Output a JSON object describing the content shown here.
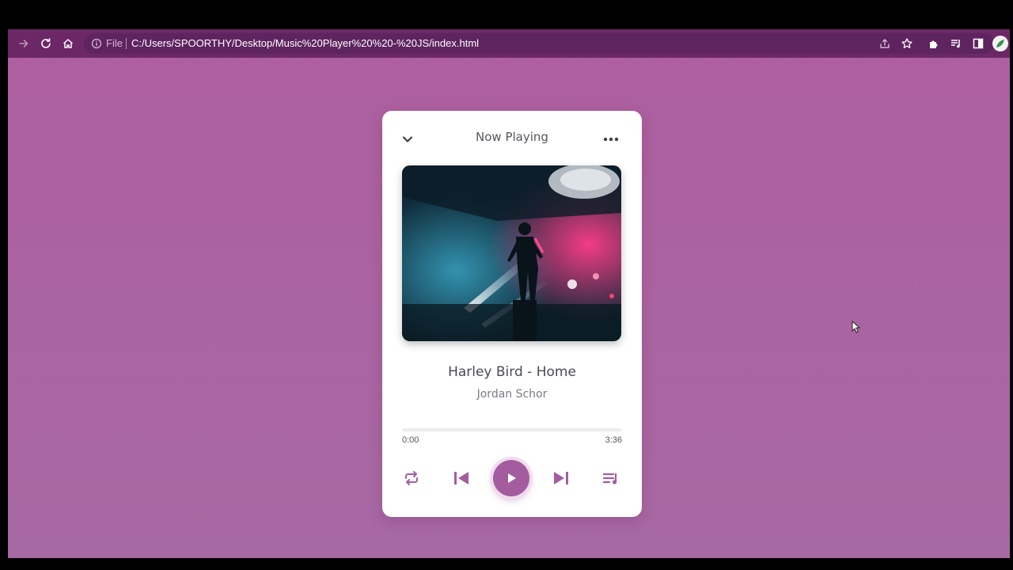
{
  "browser": {
    "address": {
      "scheme_label": "File",
      "url": "C:/Users/SPOORTHY/Desktop/Music%20Player%20%20-%20JS/index.html"
    }
  },
  "player": {
    "header": {
      "title": "Now Playing"
    },
    "track": {
      "title": "Harley Bird - Home",
      "artist": "Jordan Schor"
    },
    "progress": {
      "current": "0:00",
      "duration": "3:36",
      "fraction": 0
    },
    "accent_color": "#a35d9f"
  }
}
